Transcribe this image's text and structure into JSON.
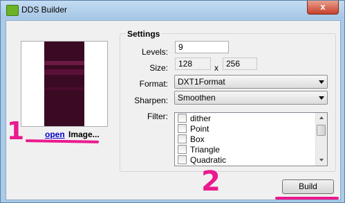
{
  "window": {
    "title": "DDS Builder",
    "close_symbol": "x",
    "icon": "nvidia-app-icon"
  },
  "preview": {
    "open_link": "open",
    "image_label": "Image..."
  },
  "settings": {
    "group_title": "Settings",
    "levels_label": "Levels:",
    "levels_value": "9",
    "size_label": "Size:",
    "width_value": "128",
    "size_sep": "x",
    "height_value": "256",
    "format_label": "Format:",
    "format_value": "DXT1Format",
    "sharpen_label": "Sharpen:",
    "sharpen_value": "Smoothen",
    "filter_label": "Filter:",
    "filters": [
      "dither",
      "Point",
      "Box",
      "Triangle",
      "Quadratic"
    ]
  },
  "actions": {
    "build_label": "Build"
  },
  "annotations": {
    "mark1": "1",
    "mark2": "2",
    "color": "#ea1a8e"
  }
}
